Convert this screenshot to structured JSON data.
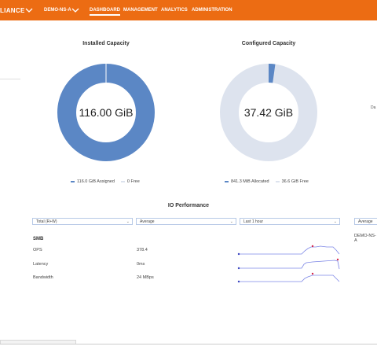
{
  "header": {
    "brand": "LIANCE",
    "namespace": "DEMO-NS-A",
    "nav": [
      "DASHBOARD",
      "MANAGEMENT",
      "ANALYTICS",
      "ADMINISTRATION"
    ],
    "active_nav": "DASHBOARD"
  },
  "installed": {
    "title": "Installed Capacity",
    "center": "116.00 GiB",
    "legend": [
      {
        "label": "116.0 GiB Assigned",
        "color": "#5b87c5"
      },
      {
        "label": "0 Free",
        "color": "#dde3ee"
      }
    ],
    "fraction_used": 0.999
  },
  "configured": {
    "title": "Configured Capacity",
    "center": "37.42 GiB",
    "legend": [
      {
        "label": "841.3 MiB Allocated",
        "color": "#5b87c5"
      },
      {
        "label": "36.6 GiB Free",
        "color": "#dde3ee"
      }
    ],
    "fraction_used": 0.022
  },
  "right_cut_label": "Da",
  "io": {
    "title": "IO Performance",
    "filters": [
      "Total (R+W)",
      "Average",
      "Last 1 hour",
      "Average"
    ],
    "section": "SMB",
    "rows": [
      {
        "label": "OPS",
        "value": "378.4"
      },
      {
        "label": "Latency",
        "value": "0ms"
      },
      {
        "label": "Bandwidth",
        "value": "24 MBps"
      }
    ],
    "namespace": "DEMO-NS-A"
  },
  "colors": {
    "header": "#ec6c13",
    "accent": "#5b87c5",
    "free": "#dde3ee"
  }
}
